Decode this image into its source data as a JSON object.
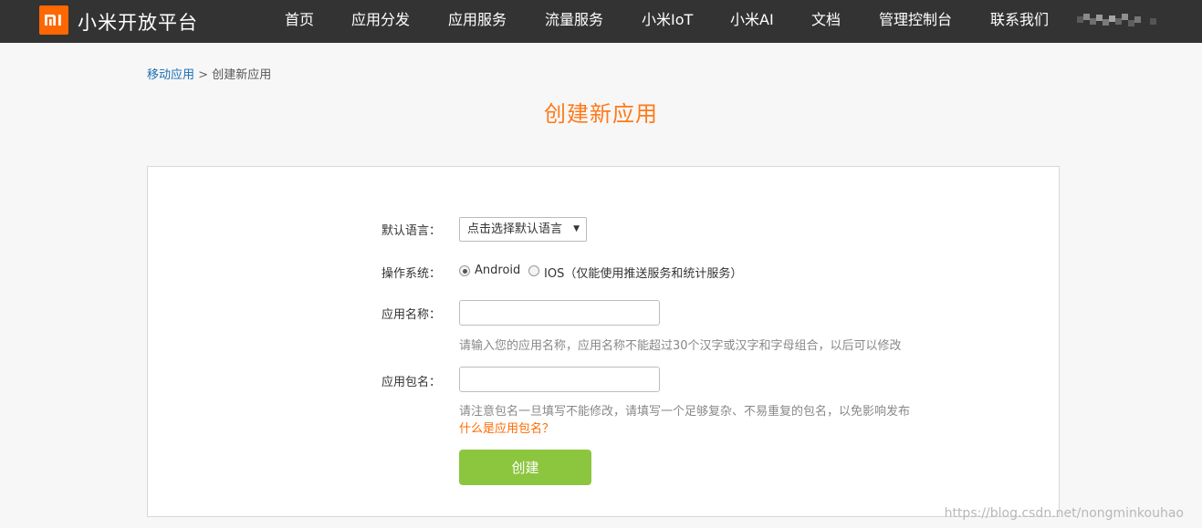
{
  "header": {
    "brand": "小米开放平台",
    "nav": [
      "首页",
      "应用分发",
      "应用服务",
      "流量服务",
      "小米IoT",
      "小米AI",
      "文档",
      "管理控制台",
      "联系我们"
    ]
  },
  "breadcrumb": {
    "parent": "移动应用",
    "separator": ">",
    "current": "创建新应用"
  },
  "page_title": "创建新应用",
  "form": {
    "language_label": "默认语言：",
    "language_value": "点击选择默认语言",
    "os_label": "操作系统：",
    "os_options": [
      "Android",
      "IOS（仅能使用推送服务和统计服务）"
    ],
    "os_selected": "Android",
    "name_label": "应用名称：",
    "name_value": "",
    "name_hint": "请输入您的应用名称，应用名称不能超过30个汉字或汉字和字母组合，以后可以修改",
    "package_label": "应用包名：",
    "package_value": "",
    "package_hint": "请注意包名一旦填写不能修改，请填写一个足够复杂、不易重复的包名，以免影响发布",
    "package_help_link": "什么是应用包名？",
    "submit_label": "创建"
  },
  "watermark": "https://blog.csdn.net/nongminkouhao",
  "colors": {
    "header_bg": "#333333",
    "brand_orange": "#ff6700",
    "title_orange": "#ff7a1a",
    "button_green": "#8cc63f",
    "link_blue": "#1a6fb5"
  }
}
